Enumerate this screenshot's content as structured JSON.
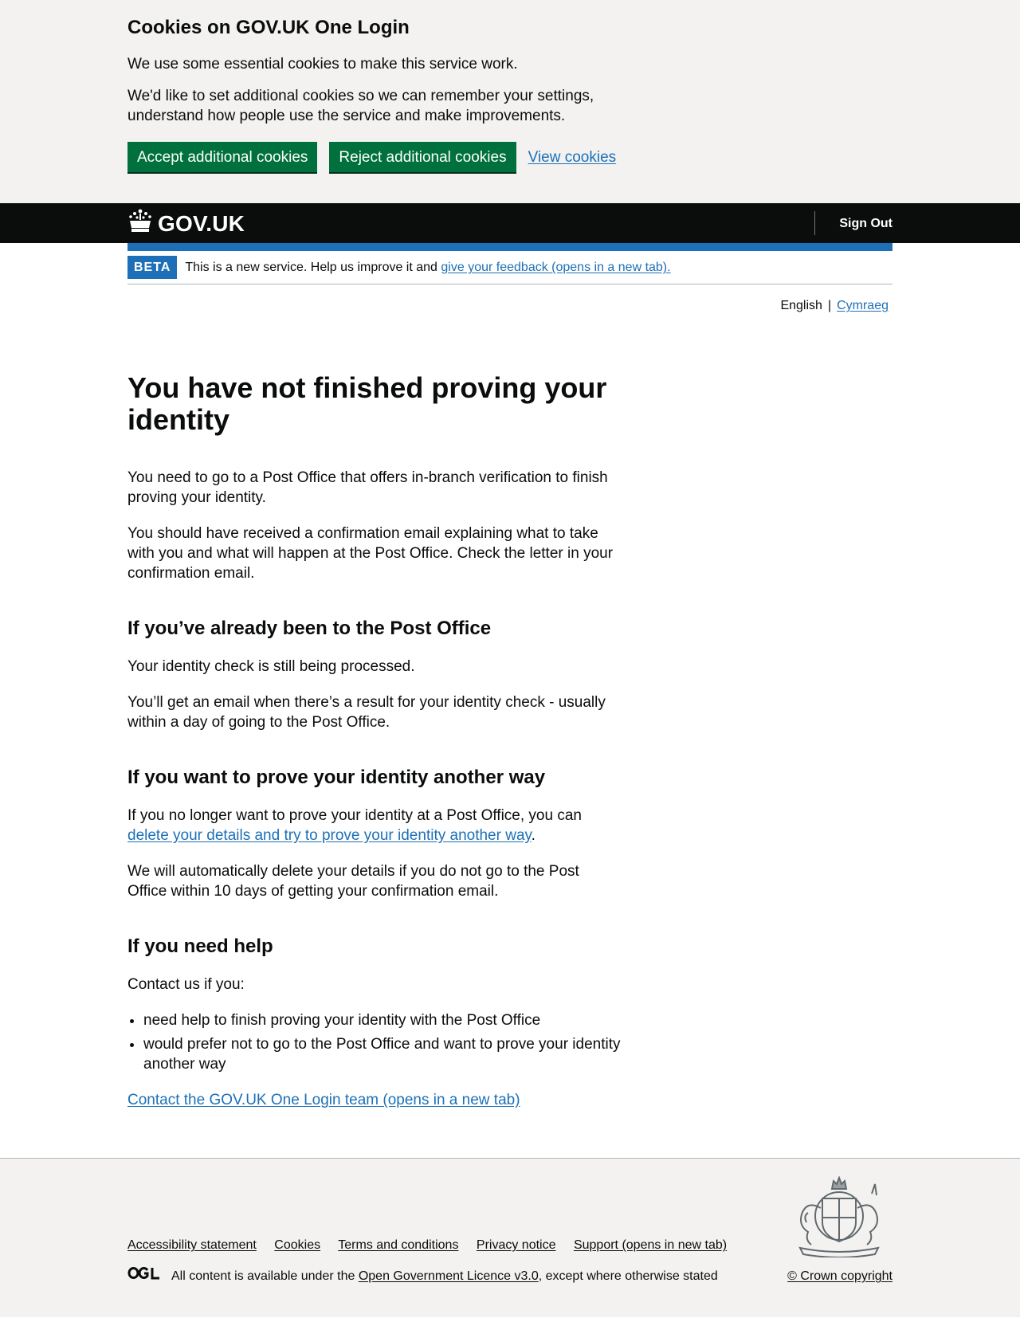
{
  "cookie_banner": {
    "title": "Cookies on GOV.UK One Login",
    "para1": "We use some essential cookies to make this service work.",
    "para2": "We'd like to set additional cookies so we can remember your settings, understand how people use the service and make improvements.",
    "accept_label": "Accept additional cookies",
    "reject_label": "Reject additional cookies",
    "view_label": "View cookies"
  },
  "header": {
    "logo_text": "GOV.UK",
    "signout_label": "Sign Out"
  },
  "phase_banner": {
    "tag": "BETA",
    "text": "This is a new service. Help us improve it and",
    "link": "give your feedback (opens in a new tab)."
  },
  "language": {
    "current": "English",
    "separator": "|",
    "other": "Cymraeg"
  },
  "main": {
    "title": "You have not finished proving your identity",
    "intro1": "You need to go to a Post Office that offers in-branch verification to finish proving your identity.",
    "intro2": "You should have received a confirmation email explaining what to take with you and what will happen at the Post Office. Check the letter in your confirmation email.",
    "section1_heading": "If you’ve already been to the Post Office",
    "section1_p1": "Your identity check is still being processed.",
    "section1_p2": "You’ll get an email when there’s a result for your identity check - usually within a day of going to the Post Office.",
    "section2_heading": "If you want to prove your identity another way",
    "section2_p1_before": "If you no longer want to prove your identity at a Post Office, you can",
    "section2_p1_link": "delete your details and try to prove your identity another way",
    "section2_p1_after": ".",
    "section2_p2": "We will automatically delete your details if you do not go to the Post Office within 10 days of getting your confirmation email.",
    "section3_heading": "If you need help",
    "section3_p1": "Contact us if you:",
    "section3_list": [
      "need help to finish proving your identity with the Post Office",
      "would prefer not to go to the Post Office and want to prove your identity another way"
    ],
    "contact_link": "Contact the GOV.UK One Login team (opens in a new tab)"
  },
  "footer": {
    "links": [
      "Accessibility statement",
      "Cookies",
      "Terms and conditions",
      "Privacy notice",
      "Support (opens in new tab)"
    ],
    "ogl_logo": "OGL",
    "licence_before": "All content is available under the",
    "licence_link": "Open Government Licence v3.0",
    "licence_after": ", except where otherwise stated",
    "copyright": "© Crown copyright",
    "crest_icon": "royal-coat-of-arms-icon"
  }
}
